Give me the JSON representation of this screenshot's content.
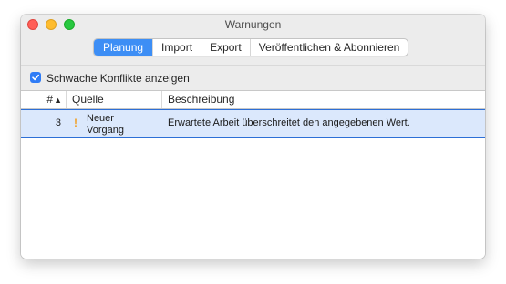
{
  "window": {
    "title": "Warnungen"
  },
  "tabs": [
    {
      "label": "Planung",
      "active": true
    },
    {
      "label": "Import",
      "active": false
    },
    {
      "label": "Export",
      "active": false
    },
    {
      "label": "Veröffentlichen & Abonnieren",
      "active": false
    }
  ],
  "options": {
    "show_weak_conflicts_label": "Schwache Konflikte anzeigen",
    "show_weak_conflicts_checked": true
  },
  "table": {
    "columns": {
      "number": "#",
      "sort_indicator": "▲",
      "source": "Quelle",
      "description": "Beschreibung"
    },
    "rows": [
      {
        "number": "3",
        "warning_icon": "!",
        "source": "Neuer Vorgang",
        "description": "Erwartete Arbeit überschreitet den angegebenen Wert.",
        "selected": true
      }
    ]
  },
  "colors": {
    "accent": "#3d8ef5",
    "selection_bg": "#dbe8fc",
    "selection_border": "#2d6fd6",
    "warning": "#f0a12a"
  }
}
